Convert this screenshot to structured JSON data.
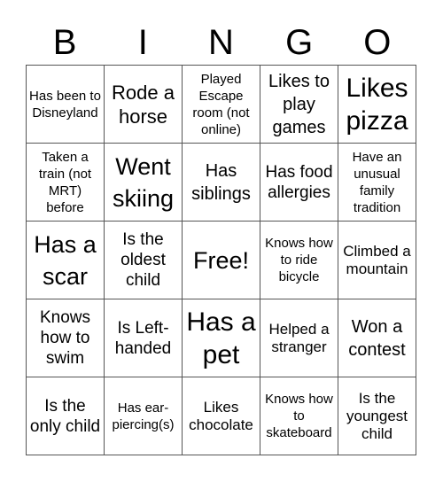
{
  "title_letters": [
    "B",
    "I",
    "N",
    "G",
    "O"
  ],
  "cells": [
    {
      "text": "Has been to Disneyland",
      "size": "s14"
    },
    {
      "text": "Rode a horse",
      "size": "s22"
    },
    {
      "text": "Played Escape room (not online)",
      "size": "s14"
    },
    {
      "text": "Likes to play games",
      "size": "s20"
    },
    {
      "text": "Likes pizza",
      "size": "s30"
    },
    {
      "text": "Taken a train (not MRT) before",
      "size": "s14"
    },
    {
      "text": "Went skiing",
      "size": "s26"
    },
    {
      "text": "Has siblings",
      "size": "s20"
    },
    {
      "text": "Has food allergies",
      "size": "s18"
    },
    {
      "text": "Have an unusual family tradition",
      "size": "s14"
    },
    {
      "text": "Has a scar",
      "size": "s26"
    },
    {
      "text": "Is the oldest child",
      "size": "s18"
    },
    {
      "text": "Free!",
      "size": "s26"
    },
    {
      "text": "Knows how to ride bicycle",
      "size": "s14"
    },
    {
      "text": "Climbed a mountain",
      "size": "s16"
    },
    {
      "text": "Knows how to swim",
      "size": "s18"
    },
    {
      "text": "Is Left-handed",
      "size": "s18"
    },
    {
      "text": "Has a pet",
      "size": "s30"
    },
    {
      "text": "Helped a stranger",
      "size": "s16"
    },
    {
      "text": "Won a contest",
      "size": "s20"
    },
    {
      "text": "Is the only child",
      "size": "s18"
    },
    {
      "text": "Has ear-piercing(s)",
      "size": "s14"
    },
    {
      "text": "Likes chocolate",
      "size": "s16"
    },
    {
      "text": "Knows how to skateboard",
      "size": "s14"
    },
    {
      "text": "Is the youngest child",
      "size": "s16"
    }
  ]
}
